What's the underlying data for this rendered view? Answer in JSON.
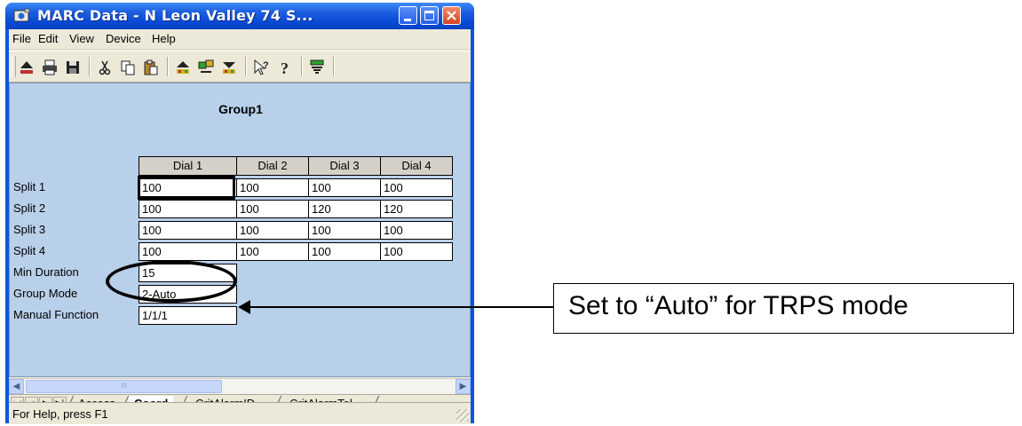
{
  "window": {
    "title": "MARC Data - N Leon Valley 74    S..."
  },
  "menu": [
    "File",
    "Edit",
    "View",
    "Device",
    "Help"
  ],
  "toolbar_icons": [
    "eject-icon",
    "print-icon",
    "save-icon",
    "cut-icon",
    "copy-icon",
    "paste-icon",
    "upload-icon",
    "compare-icon",
    "download-icon",
    "context-help-icon",
    "help-icon",
    "monitor-icon"
  ],
  "grid": {
    "title": "Group1",
    "columns": [
      "Dial 1",
      "Dial 2",
      "Dial 3",
      "Dial 4"
    ],
    "rows": [
      {
        "label": "Split 1",
        "values": [
          "100",
          "100",
          "100",
          "100"
        ]
      },
      {
        "label": "Split 2",
        "values": [
          "100",
          "100",
          "120",
          "120"
        ]
      },
      {
        "label": "Split 3",
        "values": [
          "100",
          "100",
          "100",
          "100"
        ]
      },
      {
        "label": "Split 4",
        "values": [
          "100",
          "100",
          "100",
          "100"
        ]
      },
      {
        "label": "Min Duration",
        "values": [
          "15"
        ]
      },
      {
        "label": "Group Mode",
        "values": [
          "2-Auto"
        ]
      },
      {
        "label": "Manual Function",
        "values": [
          "1/1/1"
        ]
      }
    ]
  },
  "tabs": {
    "items": [
      "Access",
      "Coord",
      "CritAlarmID",
      "CritAlarmTel"
    ],
    "active": "Coord"
  },
  "scrollbar": {
    "thumb_mark": "III"
  },
  "status": {
    "text": "For Help, press F1"
  },
  "callout": {
    "text": "Set to “Auto” for TRPS mode"
  },
  "colors": {
    "title_bar": "#0a4bd6",
    "content_bg": "#b9d0ea",
    "chrome": "#ece9d8"
  }
}
